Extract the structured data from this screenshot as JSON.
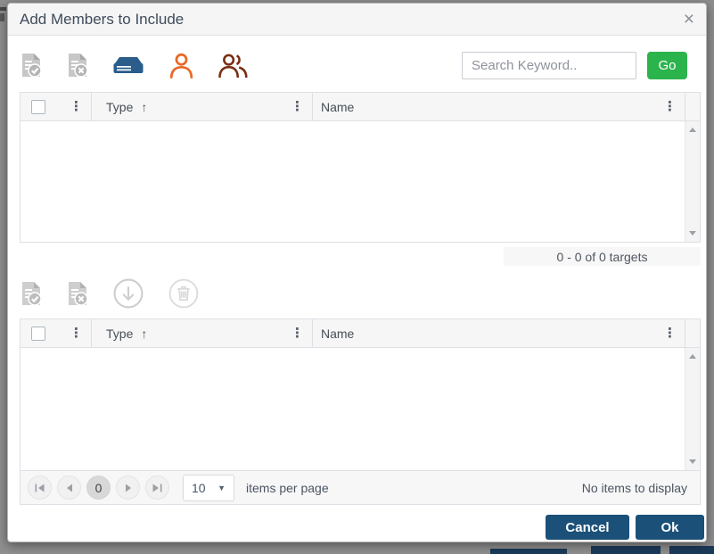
{
  "colors": {
    "go_green": "#2bb34c",
    "footer_navy": "#1b5078",
    "drive_steel_blue": "#2a5d8c",
    "user_orange": "#e96724",
    "group_maroon": "#7b2d12",
    "header_bg": "#f5f5f5",
    "grid_border": "#dde0e4"
  },
  "icons": {
    "close": "×",
    "sort_ascending": "↑",
    "column_menu": "⋮",
    "dropdown_caret": "▼"
  },
  "dialog": {
    "title": "Add Members to Include"
  },
  "top_toolbar": {
    "icon_names": [
      "document-check-icon",
      "document-x-icon",
      "targets-drive-icon",
      "user-icon",
      "group-icon"
    ],
    "search": {
      "placeholder": "Search Keyword.."
    },
    "go_button": "Go"
  },
  "available_grid": {
    "columns": {
      "type": "Type",
      "name": "Name"
    },
    "sorted_by": "Type",
    "sort_direction": "ascending",
    "rows": [],
    "info": "0 - 0 of 0 targets"
  },
  "bottom_toolbar": {
    "icon_names": [
      "document-check-icon",
      "document-x-icon",
      "move-down-icon",
      "delete-icon"
    ]
  },
  "selected_grid": {
    "columns": {
      "type": "Type",
      "name": "Name"
    },
    "sorted_by": "Type",
    "sort_direction": "ascending",
    "rows": [],
    "pager": {
      "current_page": "0",
      "page_size": "10",
      "items_per_page_label": "items per page",
      "status": "No items to display"
    }
  },
  "footer": {
    "cancel_button": "Cancel",
    "ok_button": "Ok"
  }
}
